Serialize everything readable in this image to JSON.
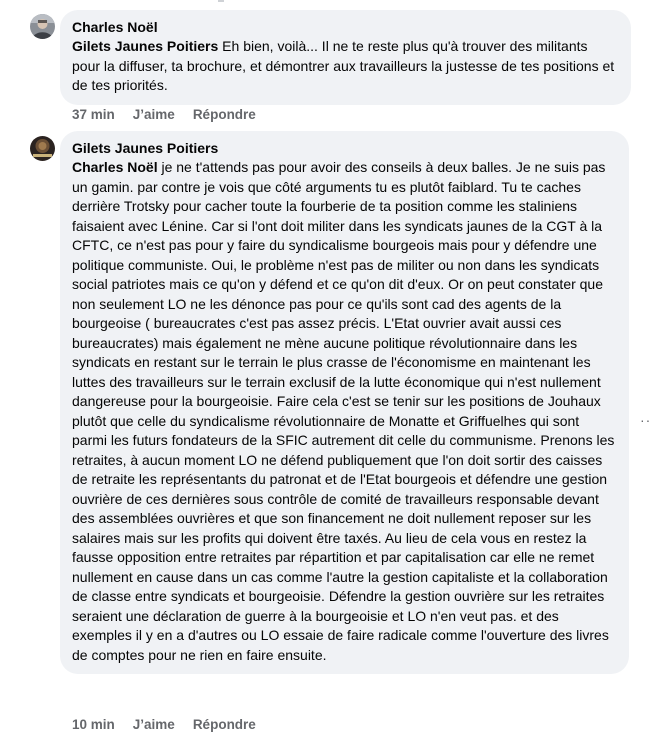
{
  "comments": [
    {
      "author": "Charles Noël",
      "mention": "Gilets Jaunes Poitiers",
      "body": " Eh bien, voilà... Il ne te reste plus qu'à trouver des militants pour la diffuser, ta brochure, et démontrer aux travailleurs la justesse de tes positions et de tes priorités.",
      "time": "37 min",
      "like_label": "J’aime",
      "reply_label": "Répondre"
    },
    {
      "author": "Gilets Jaunes Poitiers",
      "mention": "Charles Noël",
      "body": " je ne t'attends pas pour avoir des conseils à deux balles. Je ne suis pas un gamin. par contre je vois que côté arguments tu es plutôt faiblard. Tu te caches derrière Trotsky pour cacher toute la fourberie de ta position comme les staliniens faisaient avec Lénine. Car si l'ont doit militer dans les syndicats jaunes de la CGT à la CFTC, ce n'est pas pour y faire du syndicalisme bourgeois mais pour y défendre une politique communiste. Oui, le problème n'est pas de militer ou non dans les syndicats social patriotes mais ce qu'on y défend et ce qu'on dit d'eux. Or on peut constater que non seulement LO ne les dénonce pas pour ce qu'ils sont cad des agents de la bourgeoise ( bureaucrates c'est pas assez précis. L'Etat ouvrier avait aussi ces bureaucrates) mais également ne mène aucune politique révolutionnaire dans les syndicats en restant sur le terrain le plus crasse de l'économisme en maintenant les luttes des travailleurs sur le terrain exclusif de la lutte économique qui n'est nullement dangereuse pour la bourgeoisie. Faire cela c'est se tenir sur les positions de Jouhaux plutôt que celle du syndicalisme révolutionnaire de Monatte et Griffuelhes qui sont parmi les futurs fondateurs de la SFIC autrement dit celle du communisme. Prenons les retraites, à aucun moment LO ne défend publiquement que l'on doit sortir des caisses de retraite les représentants du patronat et de l'Etat bourgeois et défendre une gestion ouvrière de ces dernières sous contrôle de comité de travailleurs responsable devant des assemblées ouvrières et que son financement ne doit nullement reposer sur les salaires mais sur les profits qui doivent être taxés. Au lieu de cela vous en restez la fausse opposition entre retraites par répartition et par capitalisation car elle ne remet nullement en cause dans un cas comme l'autre la gestion capitaliste et la collaboration de classe entre syndicats et bourgeoisie. Défendre la gestion ouvrière sur les retraites seraient une déclaration de guerre à la bourgeoisie et LO n'en veut pas. et des exemples il y en a d'autres ou LO essaie de faire radicale comme l'ouverture des livres de comptes pour ne rien en faire ensuite.",
      "time": "10 min",
      "like_label": "J’aime",
      "reply_label": "Répondre"
    }
  ],
  "icons": {
    "avatar_1": "user-photo-avatar",
    "avatar_2": "group-logo-avatar",
    "more": "more-options-icon"
  },
  "colors": {
    "bubble_bg": "#f0f2f5",
    "secondary_text": "#65676b",
    "primary_text": "#050505"
  }
}
